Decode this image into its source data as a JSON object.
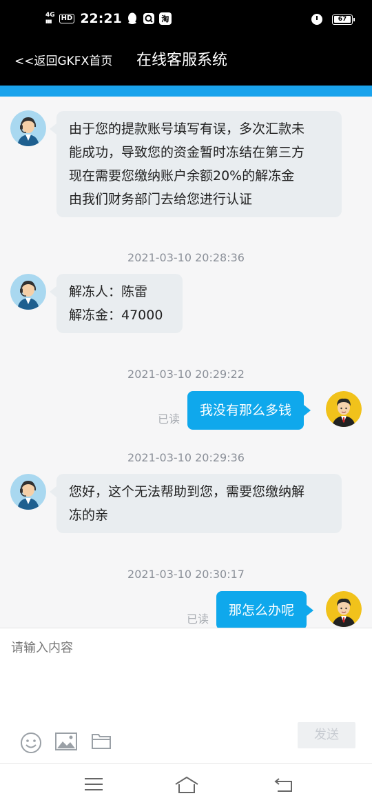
{
  "status_bar": {
    "network": "4G",
    "hd": "HD",
    "time": "22:21",
    "app_badge": "淘",
    "battery": "67"
  },
  "header": {
    "back_label": "<<返回GKFX首页",
    "title": "在线客服系统"
  },
  "messages": [
    {
      "side": "left",
      "text": [
        "由于您的提款账号填写有误，多次汇款未",
        "能成功，导致您的资金暂时冻结在第三方",
        "现在需要您缴纳账户余额20%的解冻金",
        "由我们财务部门去给您进行认证"
      ]
    },
    {
      "timestamp": "2021-03-10 20:28:36"
    },
    {
      "side": "left",
      "text": [
        "解冻人：陈雷",
        "解冻金：47000"
      ]
    },
    {
      "timestamp": "2021-03-10 20:29:22"
    },
    {
      "side": "right",
      "text": "我没有那么多钱",
      "status": "已读"
    },
    {
      "timestamp": "2021-03-10 20:29:36"
    },
    {
      "side": "left",
      "text": [
        "您好，这个无法帮助到您，需要您缴纳解",
        "冻的亲"
      ]
    },
    {
      "timestamp": "2021-03-10 20:30:17"
    },
    {
      "side": "right",
      "text": "那怎么办呢",
      "status": "已读"
    }
  ],
  "input": {
    "placeholder": "请输入内容",
    "send_label": "发送"
  },
  "colors": {
    "accent": "#0fa8ec",
    "header_bg": "#000000",
    "incoming_bubble": "#e9edf0"
  },
  "icons": [
    "emoji-icon",
    "image-icon",
    "folder-icon",
    "menu-icon",
    "home-icon",
    "back-icon"
  ]
}
